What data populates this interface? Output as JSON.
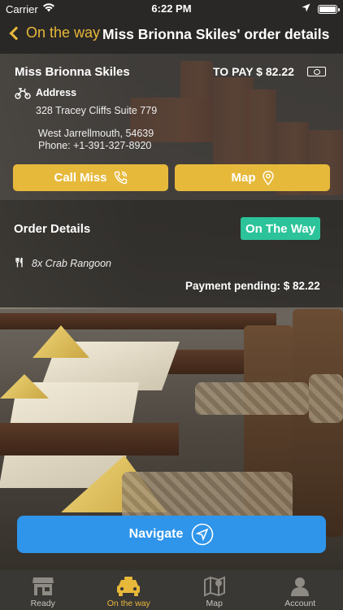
{
  "status_bar": {
    "carrier": "Carrier",
    "time": "6:22 PM"
  },
  "nav": {
    "back_label": "On the way",
    "title": "Miss Brionna Skiles' order details"
  },
  "customer": {
    "name": "Miss Brionna Skiles",
    "to_pay": "TO PAY $ 82.22",
    "address_label": "Address",
    "address_line1": "328 Tracey Cliffs Suite 779",
    "address_line2": "West Jarrellmouth, 54639",
    "phone": "Phone: +1-391-327-8920"
  },
  "actions": {
    "call_label": "Call Miss",
    "map_label": "Map"
  },
  "order": {
    "title": "Order Details",
    "status_badge": "On The Way",
    "item": "8x Crab Rangoon",
    "payment": "Payment pending: $ 82.22"
  },
  "navigate_label": "Navigate",
  "tabs": [
    {
      "label": "Ready",
      "icon": "store-icon"
    },
    {
      "label": "On the way",
      "icon": "taxi-icon"
    },
    {
      "label": "Map",
      "icon": "map-icon"
    },
    {
      "label": "Account",
      "icon": "user-icon"
    }
  ],
  "colors": {
    "accent": "#e6b93b",
    "badge": "#2cc39a",
    "navigate": "#2e95ea"
  }
}
